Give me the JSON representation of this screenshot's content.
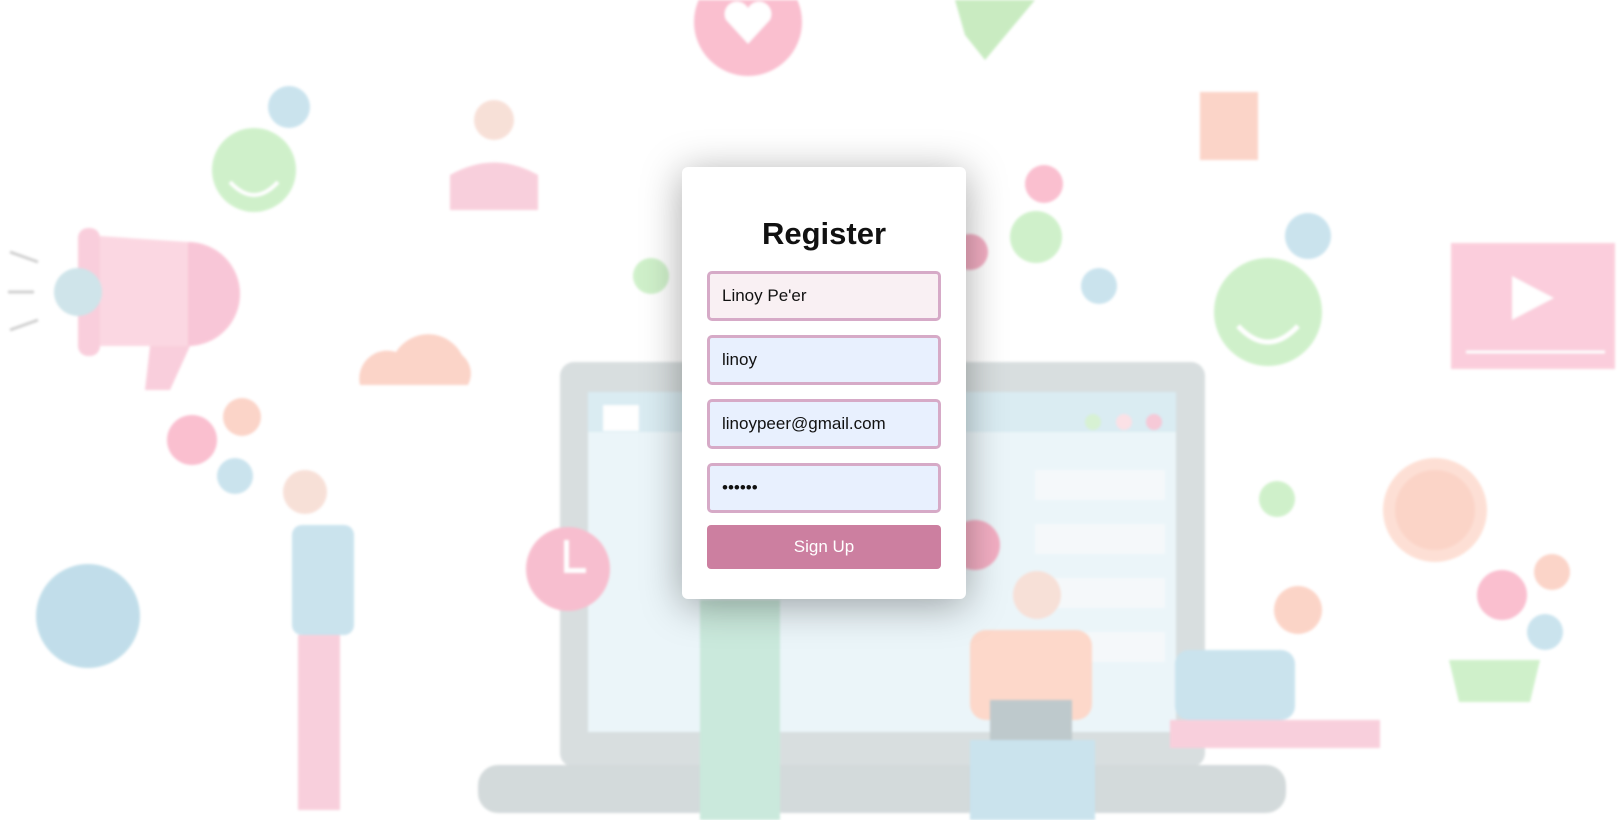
{
  "form": {
    "title": "Register",
    "name_value": "Linoy Pe'er",
    "username_value": "linoy",
    "email_value": "linoypeer@gmail.com",
    "password_value": "123456",
    "submit_label": "Sign Up"
  },
  "colors": {
    "button_bg": "#cc7fa0",
    "field_border": "#d6aac7",
    "autofill_bg": "#e8f0fe"
  },
  "icons": [
    "heart-icon",
    "like-icon",
    "smiley-icon",
    "megaphone-icon",
    "cloud-icon",
    "clock-icon",
    "dollar-coin-icon",
    "play-icon",
    "basket-icon",
    "paper-plane-icon"
  ]
}
